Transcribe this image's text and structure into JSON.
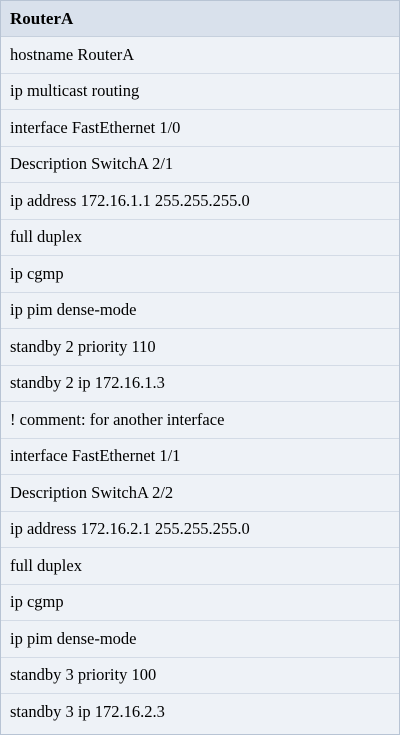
{
  "table": {
    "header": "RouterA",
    "rows": [
      "hostname RouterA",
      "ip multicast routing",
      "interface FastEthernet 1/0",
      "Description SwitchA 2/1",
      "ip address 172.16.1.1 255.255.255.0",
      "full duplex",
      "ip cgmp",
      "ip pim dense-mode",
      "standby 2 priority 110",
      "standby 2 ip 172.16.1.3",
      "! comment: for another interface",
      "interface FastEthernet 1/1",
      "Description SwitchA 2/2",
      "ip address 172.16.2.1 255.255.255.0",
      "full duplex",
      "ip cgmp",
      "ip pim dense-mode",
      "standby 3 priority 100",
      "standby 3 ip 172.16.2.3"
    ]
  }
}
